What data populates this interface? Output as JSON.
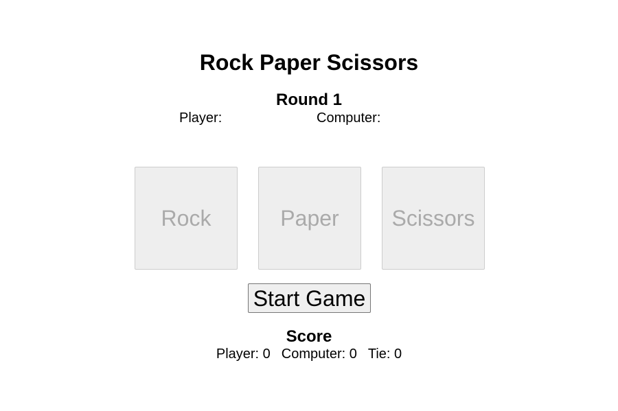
{
  "title": "Rock Paper Scissors",
  "round": {
    "label": "Round 1",
    "player_choice": "Player:",
    "computer_choice": "Computer:"
  },
  "choices": [
    {
      "label": "Rock",
      "enabled": false
    },
    {
      "label": "Paper",
      "enabled": false
    },
    {
      "label": "Scissors",
      "enabled": false
    }
  ],
  "start_button": {
    "label": "Start Game"
  },
  "score": {
    "title": "Score",
    "player": "Player: 0",
    "computer": "Computer: 0",
    "tie": "Tie: 0"
  },
  "colors": {
    "card_background": "#eeeeee",
    "card_border": "#cccccc",
    "card_text_disabled": "#aaaaaa",
    "button_background": "#efefef",
    "button_border": "#767676"
  }
}
